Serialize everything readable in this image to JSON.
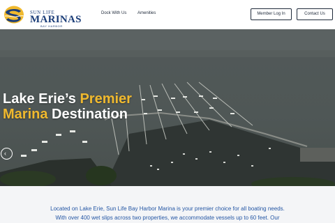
{
  "brand": {
    "line1": "SUN LIFE",
    "line2": "MARINAS",
    "line3": "BAY HARBOR",
    "colors": {
      "navy": "#1b3d78",
      "gold": "#f0b92e"
    }
  },
  "nav": {
    "items": [
      {
        "label": "Dock With Us"
      },
      {
        "label": "Amenities"
      }
    ],
    "member_login": "Member Log In",
    "contact_us": "Contact Us"
  },
  "hero": {
    "title_part1": "Lake Erie’s ",
    "title_highlight1": "Premier",
    "title_highlight2": "Marina",
    "title_part2": " Destination",
    "slider_icon": "chevron-left-icon"
  },
  "intro": {
    "line1": "Located on Lake Erie, Sun Life Bay Harbor Marina is your premier choice for all boating needs.",
    "line2": "With over 400 wet slips across two properties, we accommodate vessels up to 60 feet. Our"
  }
}
